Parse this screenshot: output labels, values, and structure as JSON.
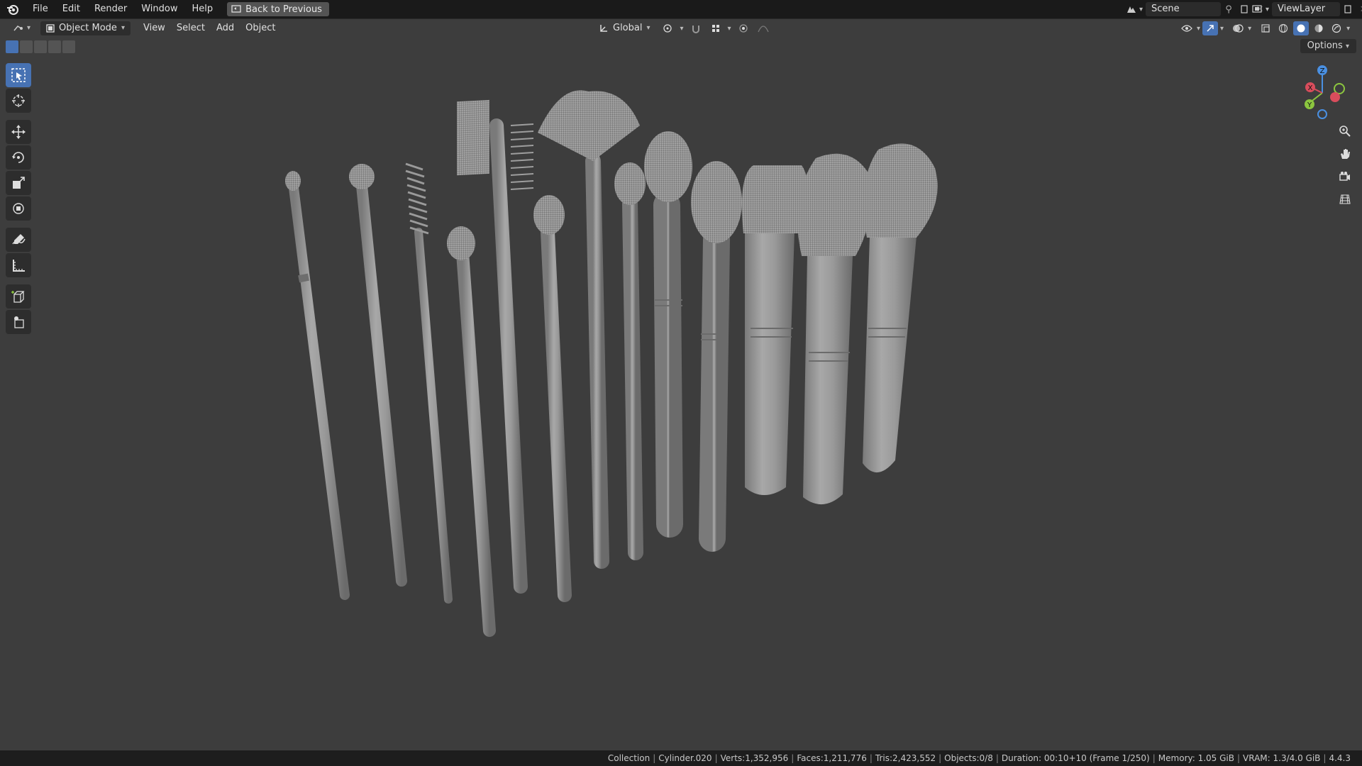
{
  "menu": {
    "file": "File",
    "edit": "Edit",
    "render": "Render",
    "window": "Window",
    "help": "Help",
    "back": "Back to Previous"
  },
  "top_right": {
    "scene": "Scene",
    "view_layer": "ViewLayer"
  },
  "viewport_header": {
    "mode": "Object Mode",
    "view": "View",
    "select": "Select",
    "add": "Add",
    "object": "Object",
    "orientation": "Global",
    "options": "Options"
  },
  "gizmo": {
    "x": "X",
    "y": "Y",
    "z": "Z"
  },
  "status": {
    "collection": "Collection",
    "object": "Cylinder.020",
    "verts": "Verts:1,352,956",
    "faces": "Faces:1,211,776",
    "tris": "Tris:2,423,552",
    "objects": "Objects:0/8",
    "duration": "Duration: 00:10+10 (Frame 1/250)",
    "memory": "Memory: 1.05 GiB",
    "vram": "VRAM: 1.3/4.0 GiB",
    "version": "4.4.3"
  },
  "colors": {
    "accent": "#4772b3",
    "viewport_bg": "#3d3d3d",
    "axis_x": "#d94d5c",
    "axis_y": "#8cc63f",
    "axis_z": "#4a90e2"
  }
}
